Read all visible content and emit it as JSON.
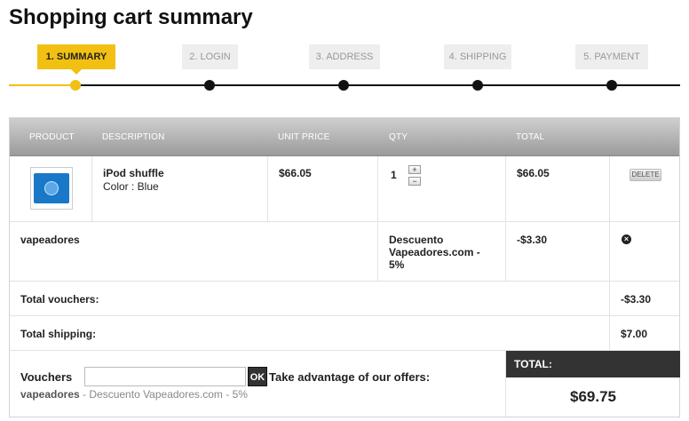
{
  "page": {
    "title": "Shopping cart summary"
  },
  "steps": [
    {
      "label": "1. Summary",
      "active": true
    },
    {
      "label": "2. Login",
      "active": false
    },
    {
      "label": "3. Address",
      "active": false
    },
    {
      "label": "4. Shipping",
      "active": false
    },
    {
      "label": "5. Payment",
      "active": false
    }
  ],
  "table": {
    "headers": {
      "product": "Product",
      "description": "Description",
      "unit_price": "Unit price",
      "qty": "Qty",
      "total": "Total"
    },
    "product_row": {
      "image_icon": "ipod-shuffle-image",
      "name": "iPod shuffle",
      "attributes": "Color : Blue",
      "unit_price": "$66.05",
      "quantity": "1",
      "increase_symbol": "+",
      "decrease_symbol": "−",
      "total": "$66.05",
      "delete_label": "DELETE"
    },
    "discount_row": {
      "name": "vapeadores",
      "description": "Descuento Vapeadores.com - 5%",
      "value": "-$3.30",
      "remove_symbol": "×"
    },
    "total_vouchers": {
      "label": "Total vouchers:",
      "value": "-$3.30"
    },
    "total_shipping": {
      "label": "Total shipping:",
      "value": "$7.00"
    },
    "voucher_section": {
      "label": "Vouchers",
      "input_value": "",
      "input_placeholder": "",
      "ok_label": "OK",
      "offers_label": "Take advantage of our offers:",
      "offer_code": "vapeadores",
      "offer_desc": " - Descuento Vapeadores.com - 5%"
    },
    "grand_total": {
      "label": "TOTAL:",
      "value": "$69.75"
    }
  },
  "colors": {
    "accent": "#f2c012",
    "header_gradient_top": "#cfcfcf",
    "header_gradient_bottom": "#9b9b9b",
    "dark": "#333333"
  }
}
